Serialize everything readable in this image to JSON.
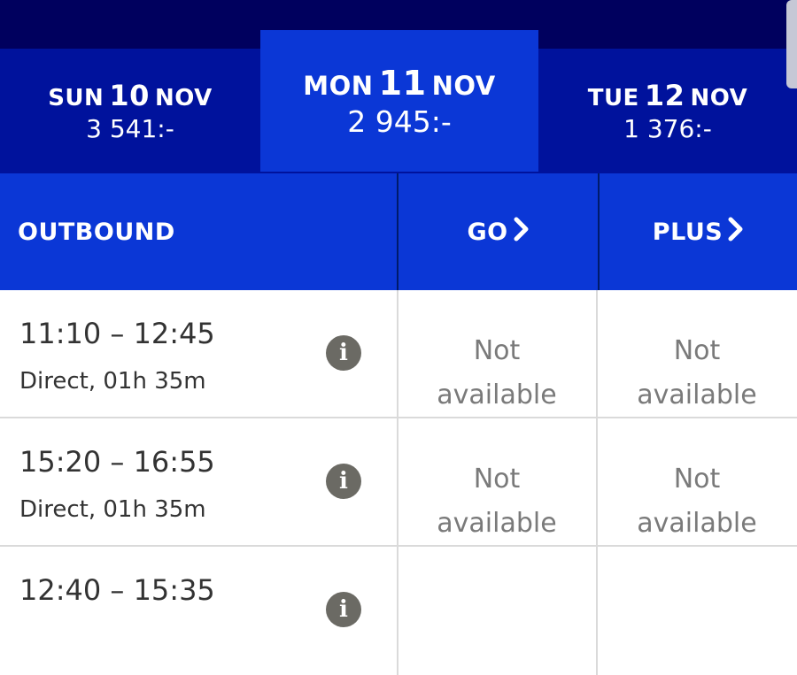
{
  "date_selector": {
    "prev": {
      "day": "SUN",
      "date": "10",
      "month": "NOV",
      "price": "3 541:-"
    },
    "selected": {
      "day": "MON",
      "date": "11",
      "month": "NOV",
      "price": "2 945:-"
    },
    "next": {
      "day": "TUE",
      "date": "12",
      "month": "NOV",
      "price": "1 376:-"
    }
  },
  "table_header": {
    "direction_label": "OUTBOUND",
    "fare_go": "GO",
    "fare_plus": "PLUS"
  },
  "flights": [
    {
      "times": "11:10 – 12:45",
      "duration": "Direct, 01h 35m",
      "go_line1": "Not",
      "go_line2": "available",
      "plus_line1": "Not",
      "plus_line2": "available"
    },
    {
      "times": "15:20 – 16:55",
      "duration": "Direct, 01h 35m",
      "go_line1": "Not",
      "go_line2": "available",
      "plus_line1": "Not",
      "plus_line2": "available"
    },
    {
      "times": "12:40 – 15:35",
      "duration": "",
      "go_line1": "",
      "go_line2": "",
      "plus_line1": "",
      "plus_line2": ""
    }
  ],
  "icons": {
    "info": "info-icon",
    "chevron": "chevron-right-icon"
  },
  "colors": {
    "nav_dark": "#00005e",
    "nav_mid": "#00129c",
    "accent_blue": "#0b37d6",
    "info_gray": "#6b6a64"
  }
}
